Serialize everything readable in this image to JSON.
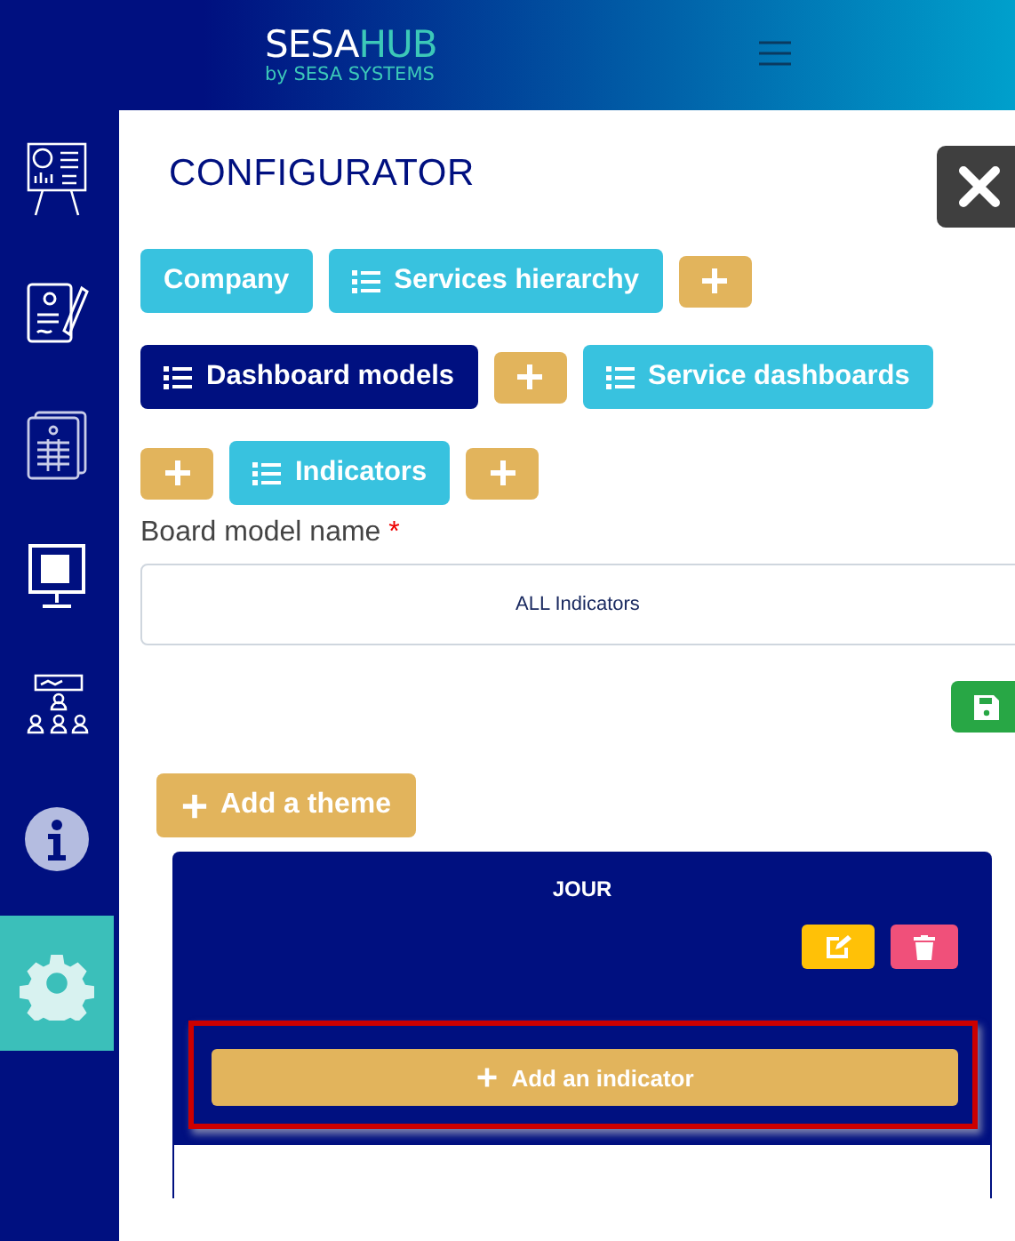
{
  "header": {
    "brand_main": "SESA",
    "brand_accent": "HUB",
    "brand_sub": "by SESA SYSTEMS"
  },
  "sidebar": {
    "items": [
      {
        "kind": "board",
        "selected": false
      },
      {
        "kind": "contract",
        "selected": false
      },
      {
        "kind": "report",
        "selected": false
      },
      {
        "kind": "presentation",
        "selected": false
      },
      {
        "kind": "team",
        "selected": false
      },
      {
        "kind": "info",
        "selected": false
      },
      {
        "kind": "settings",
        "selected": true
      }
    ]
  },
  "page": {
    "title": "CONFIGURATOR"
  },
  "nav_rows": [
    {
      "items": [
        {
          "kind": "tab",
          "label": "Company",
          "list_icon": false,
          "selected": false
        },
        {
          "kind": "tab",
          "label": "Services hierarchy",
          "list_icon": true,
          "selected": false
        },
        {
          "kind": "add"
        }
      ]
    },
    {
      "items": [
        {
          "kind": "tab",
          "label": "Dashboard models",
          "list_icon": true,
          "selected": true
        },
        {
          "kind": "add"
        },
        {
          "kind": "tab",
          "label": "Service dashboards",
          "list_icon": true,
          "selected": false
        }
      ]
    },
    {
      "items": [
        {
          "kind": "add"
        },
        {
          "kind": "tab",
          "label": "Indicators",
          "list_icon": true,
          "selected": false
        },
        {
          "kind": "add"
        }
      ]
    }
  ],
  "form": {
    "label": "Board model name",
    "required_mark": "*",
    "value": "ALL Indicators"
  },
  "add_theme": {
    "label": "Add a theme"
  },
  "theme": {
    "title": "JOUR",
    "add_indicator": "Add an indicator",
    "highlighted": true
  }
}
